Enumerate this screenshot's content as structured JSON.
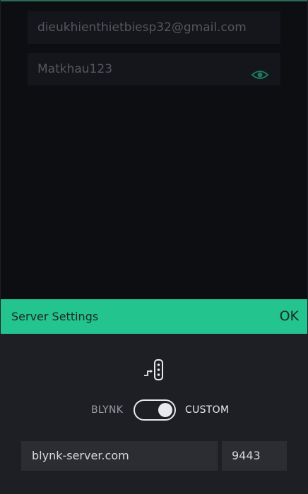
{
  "login": {
    "email_value": "dieukhienthietbiesp32@gmail.com",
    "password_value": "Matkhau123",
    "password_visibility_icon": "eye-icon"
  },
  "server_settings": {
    "title": "Server Settings",
    "ok_label": "OK",
    "icon": "server-switch-icon",
    "toggle": {
      "left_label": "BLYNK",
      "right_label": "CUSTOM",
      "selected": "CUSTOM"
    },
    "host_value": "blynk-server.com",
    "port_value": "9443"
  },
  "colors": {
    "accent": "#23c48e",
    "background": "#0d0e12",
    "dialog_background": "#1e1f25"
  }
}
